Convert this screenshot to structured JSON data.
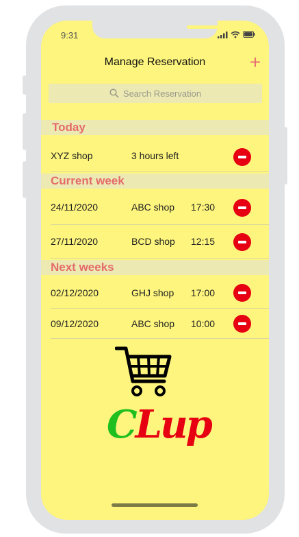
{
  "status_bar": {
    "time": "9:31"
  },
  "header": {
    "title": "Manage Reservation",
    "add_label": "+"
  },
  "search": {
    "placeholder": "Search Reservation"
  },
  "sections": [
    {
      "title": "Today",
      "items": [
        {
          "col1": "XYZ shop",
          "col2": "3 hours left",
          "col3": ""
        }
      ]
    },
    {
      "title": "Current week",
      "items": [
        {
          "col1": "24/11/2020",
          "col2": "ABC shop",
          "col3": "17:30"
        },
        {
          "col1": "27/11/2020",
          "col2": "BCD shop",
          "col3": "12:15"
        }
      ]
    },
    {
      "title": "Next weeks",
      "items": [
        {
          "col1": "02/12/2020",
          "col2": "GHJ shop",
          "col3": "17:00"
        },
        {
          "col1": "09/12/2020",
          "col2": "ABC shop",
          "col3": "10:00"
        }
      ]
    }
  ],
  "logo": {
    "text_part1": "C",
    "text_part2": "Lup",
    "color_part1": "#1fbf1f",
    "color_part2": "#e60012"
  },
  "colors": {
    "screen_bg": "#fdf57d",
    "section_bg": "#ece9b3",
    "section_text": "#e56b6b",
    "remove": "#e60012"
  }
}
